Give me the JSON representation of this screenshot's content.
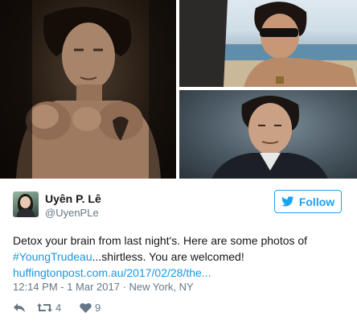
{
  "media": {
    "photos": [
      {
        "subject": "shirtless boxing pose photo"
      },
      {
        "subject": "sunglasses beach photo"
      },
      {
        "subject": "suit portrait photo"
      }
    ]
  },
  "author": {
    "display_name": "Uyên P. Lê",
    "handle": "@UyenPLe"
  },
  "follow_button": {
    "label": "Follow",
    "color": "#1da1f2"
  },
  "tweet": {
    "text_prefix": "Detox your brain from last night's. Here are some photos of ",
    "hashtag": "#YoungTrudeau",
    "text_suffix": "...shirtless. You are welcomed!",
    "link": "huffingtonpost.com.au/2017/02/28/the...",
    "link_color": "#1b95e0"
  },
  "timestamp": "12:14 PM - 1 Mar 2017 · New York, NY",
  "actions": {
    "reply_icon": "reply-icon",
    "retweet_icon": "retweet-icon",
    "retweet_count": "4",
    "like_icon": "heart-icon",
    "like_count": "9"
  }
}
